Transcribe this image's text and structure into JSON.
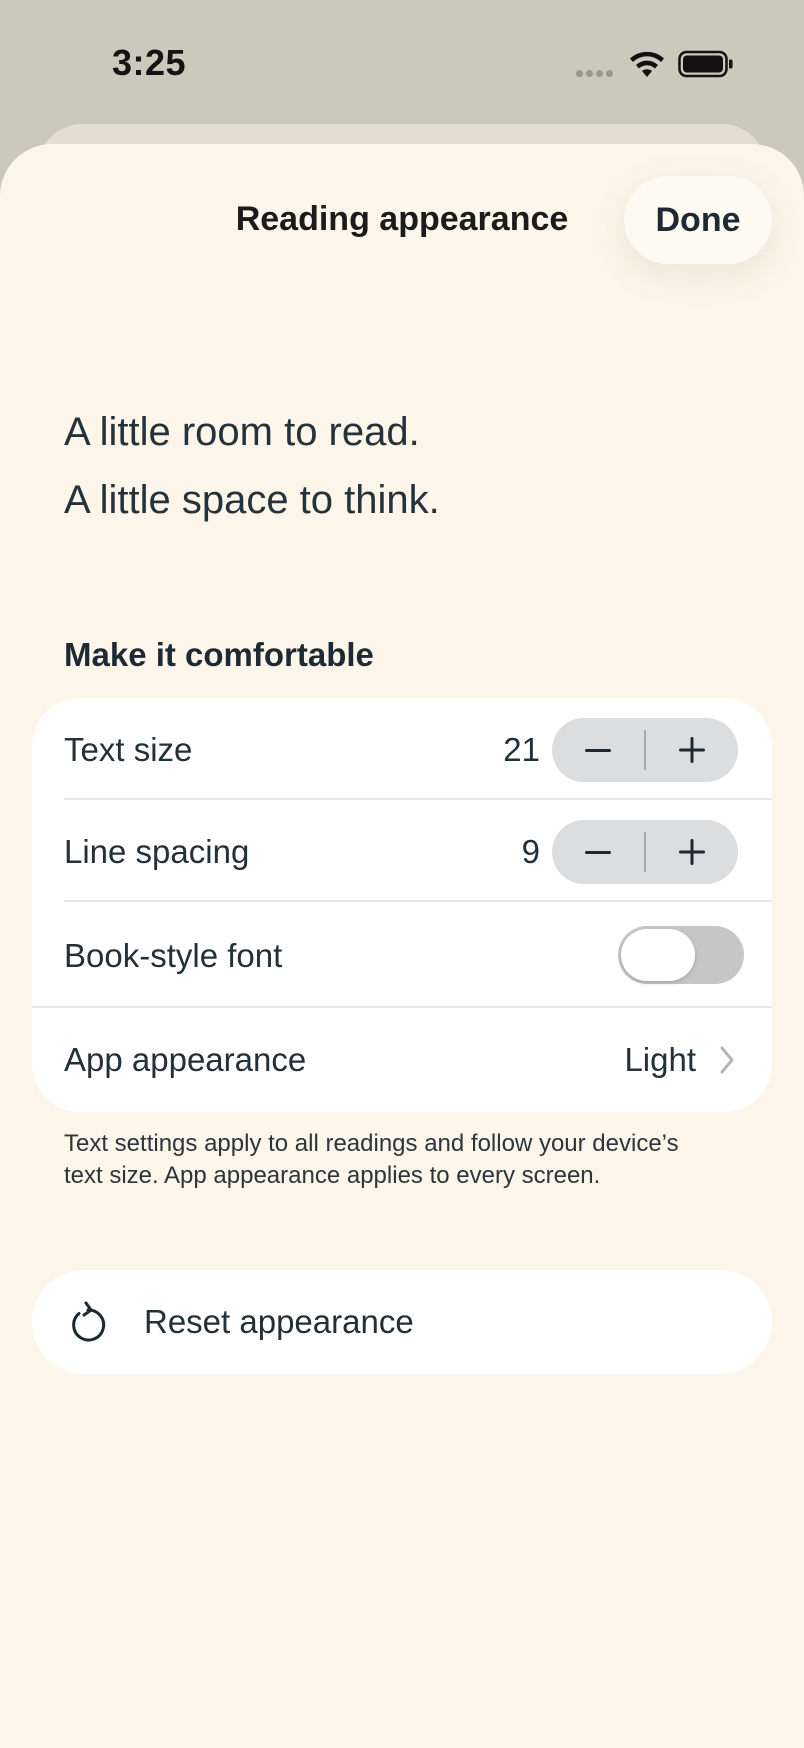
{
  "status_bar": {
    "time": "3:25"
  },
  "sheet": {
    "title": "Reading appearance",
    "done_label": "Done"
  },
  "preview": {
    "line1": "A little room to read.",
    "line2": "A little space to think."
  },
  "section_title": "Make it comfortable",
  "settings": {
    "text_size": {
      "label": "Text size",
      "value": "21"
    },
    "line_spacing": {
      "label": "Line spacing",
      "value": "9"
    },
    "book_font": {
      "label": "Book-style font",
      "enabled": false
    },
    "app_appearance": {
      "label": "App appearance",
      "value": "Light"
    }
  },
  "footnote": "Text settings apply to all readings and follow your device’s text size. App appearance applies to every screen.",
  "reset_label": "Reset appearance",
  "colors": {
    "sheet_bg": "#fbf6e9",
    "backdrop": "#cbc8bc",
    "stepper_bg": "#dcdddf",
    "toggle_off": "#c6c6c6"
  }
}
